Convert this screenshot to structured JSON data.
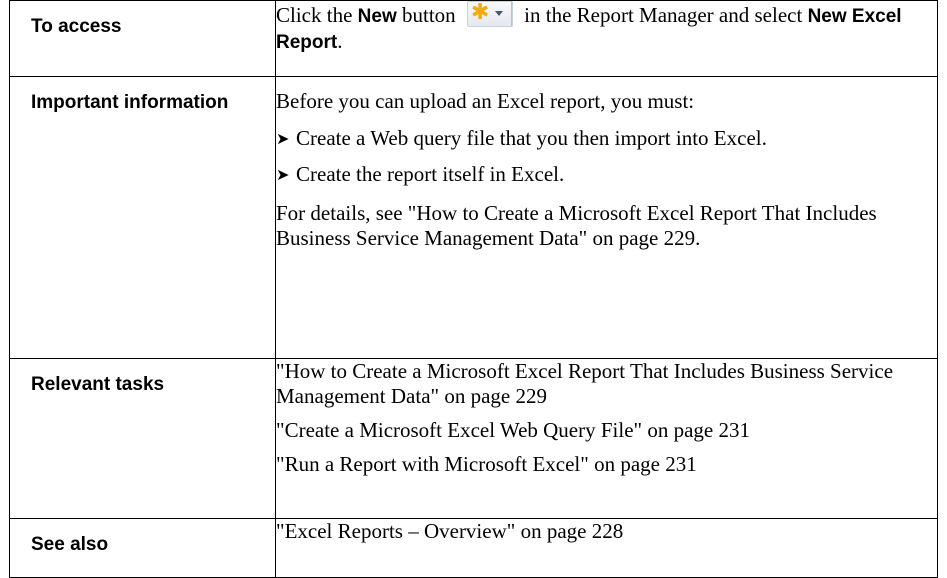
{
  "rows": {
    "access": {
      "label": "To access",
      "pre": "Click the ",
      "bold1": "New",
      "mid": " button ",
      "post": " in the Report Manager and select ",
      "bold2": "New Excel Report",
      "end": ".",
      "button_icon": "new-star-icon"
    },
    "important": {
      "label": "Important information",
      "intro": "Before you can upload an Excel report, you must:",
      "bullets": [
        "Create a Web query file that you then import into Excel.",
        "Create the report itself in Excel."
      ],
      "details": "For details, see \"How to Create a Microsoft Excel Report That Includes Business Service Management Data\" on page 229."
    },
    "tasks": {
      "label": "Relevant tasks",
      "items": [
        "\"How to Create a Microsoft Excel Report That Includes Business Service Management Data\" on page 229",
        "\"Create a Microsoft Excel Web Query File\" on page 231",
        "\"Run a Report with Microsoft Excel\" on page 231"
      ]
    },
    "see_also": {
      "label": "See also",
      "items": [
        "\"Excel Reports – Overview\" on page 228"
      ]
    }
  },
  "colors": {
    "icon_star": "#f5a90a",
    "border": "#000000"
  }
}
